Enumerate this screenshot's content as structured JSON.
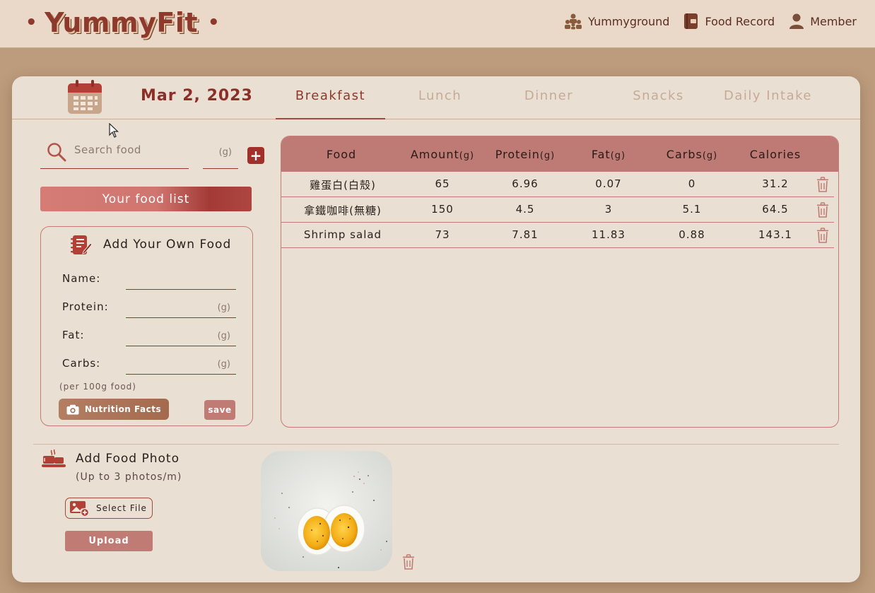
{
  "brand": {
    "name": "YummyFit",
    "dot": "•"
  },
  "nav": [
    {
      "label": "Yummyground",
      "icon": "group-icon"
    },
    {
      "label": "Food Record",
      "icon": "notebook-icon"
    },
    {
      "label": "Member",
      "icon": "user-icon"
    }
  ],
  "header": {
    "date": "Mar 2, 2023",
    "tabs": [
      "Breakfast",
      "Lunch",
      "Dinner",
      "Snacks",
      "Daily Intake"
    ],
    "active_tab": "Breakfast"
  },
  "search": {
    "placeholder": "Search food",
    "gram_unit": "(g)",
    "add_label": "+"
  },
  "food_list_button": "Your food list",
  "own_food": {
    "title": "Add Your Own Food",
    "fields": [
      {
        "label": "Name:",
        "unit": ""
      },
      {
        "label": "Protein:",
        "unit": "(g)"
      },
      {
        "label": "Fat:",
        "unit": "(g)"
      },
      {
        "label": "Carbs:",
        "unit": "(g)"
      }
    ],
    "note": "(per 100g food)",
    "nutrition_button": "Nutrition Facts",
    "save_button": "save"
  },
  "table": {
    "headers": [
      {
        "label": "Food",
        "unit": ""
      },
      {
        "label": "Amount",
        "unit": "(g)"
      },
      {
        "label": "Protein",
        "unit": "(g)"
      },
      {
        "label": "Fat",
        "unit": "(g)"
      },
      {
        "label": "Carbs",
        "unit": "(g)"
      },
      {
        "label": "Calories",
        "unit": ""
      }
    ],
    "rows": [
      [
        "雞蛋白(白殼)",
        "65",
        "6.96",
        "0.07",
        "0",
        "31.2"
      ],
      [
        "拿鐵咖啡(無糖)",
        "150",
        "4.5",
        "3",
        "5.1",
        "64.5"
      ],
      [
        "Shrimp salad",
        "73",
        "7.81",
        "11.83",
        "0.88",
        "143.1"
      ]
    ]
  },
  "photo": {
    "title": "Add Food Photo",
    "subtitle": "(Up to 3 photos/m)",
    "select_button": "Select File",
    "upload_button": "Upload"
  },
  "colors": {
    "accent": "#8d3a2c",
    "table_header": "#be7b75",
    "background": "#bd9b7d",
    "card": "#eadfd3"
  }
}
